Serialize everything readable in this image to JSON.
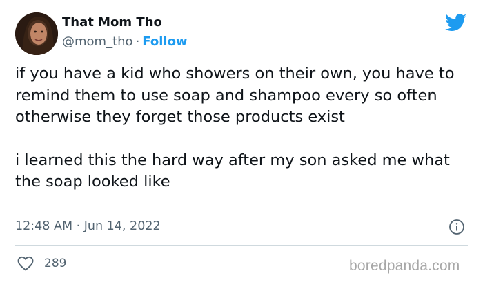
{
  "author": {
    "display_name": "That Mom Tho",
    "handle": "@mom_tho",
    "separator": "·",
    "follow_label": "Follow"
  },
  "tweet": {
    "paragraphs": [
      "if you have a kid who showers on their own, you have to remind them to use soap and shampoo every so often otherwise they forget those products exist",
      "i learned this the hard way after my son asked me what the soap looked like"
    ],
    "timestamp": "12:48 AM · Jun 14, 2022",
    "likes": "289"
  },
  "icons": {
    "brand": "twitter-bird-icon",
    "info": "info-icon",
    "like": "heart-icon"
  },
  "colors": {
    "accent": "#1d9bf0",
    "text": "#0f1419",
    "muted": "#536471",
    "divider": "#cfd9de",
    "watermark": "#a7a7a7"
  },
  "watermark": "boredpanda.com"
}
